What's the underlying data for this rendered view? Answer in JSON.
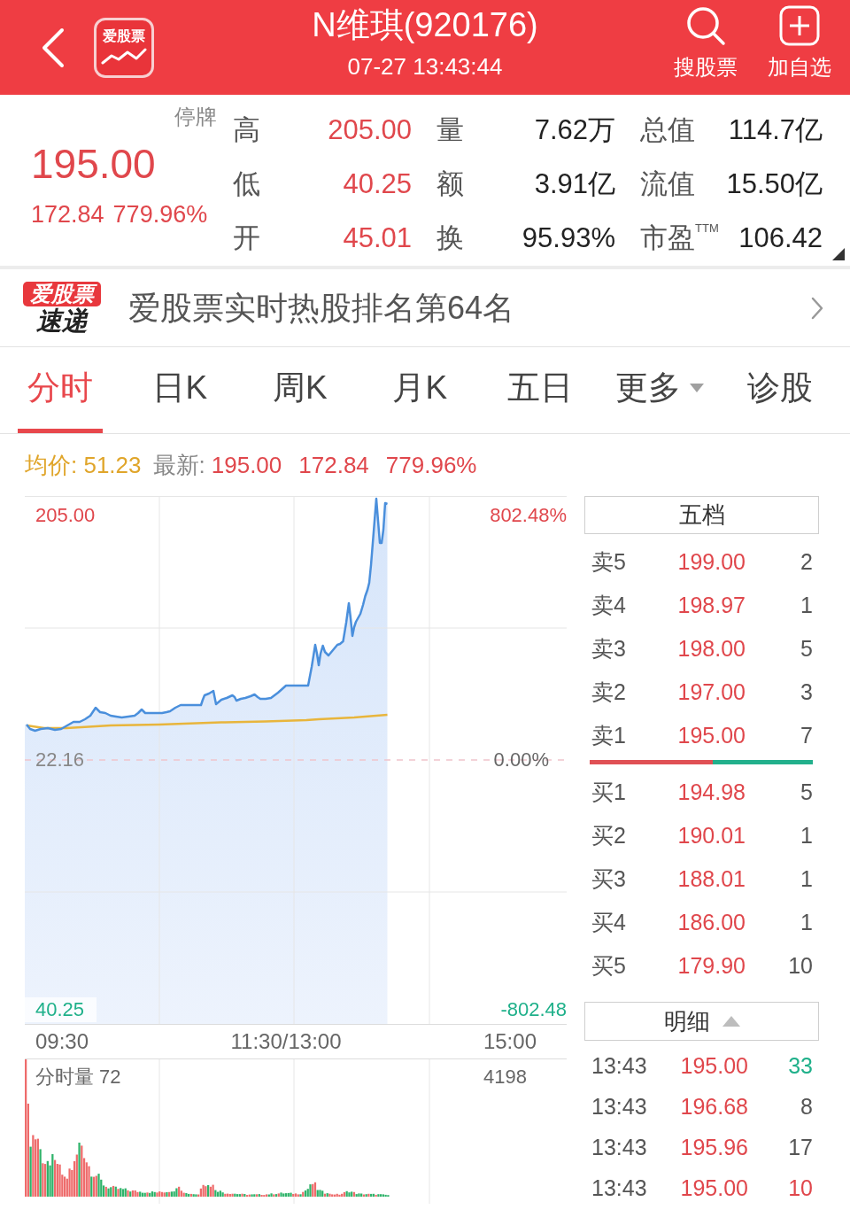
{
  "header": {
    "logo_text": "爱股票",
    "title": "N维琪(920176)",
    "time": "07-27 13:43:44",
    "actions": [
      {
        "kind": "search",
        "label": "搜股票"
      },
      {
        "kind": "add",
        "label": "加自选"
      }
    ]
  },
  "quote": {
    "status": "停牌",
    "price": "195.00",
    "change": "172.84",
    "change_percent": "779.96%",
    "stats": [
      {
        "label": "高",
        "value": "205.00",
        "color": "#e0474c"
      },
      {
        "label": "量",
        "value": "7.62万",
        "color": "#222222"
      },
      {
        "label": "总值",
        "value": "114.7亿",
        "color": "#222222"
      },
      {
        "label": "低",
        "value": "40.25",
        "color": "#e0474c"
      },
      {
        "label": "额",
        "value": "3.91亿",
        "color": "#222222"
      },
      {
        "label": "流值",
        "value": "15.50亿",
        "color": "#222222"
      },
      {
        "label": "开",
        "value": "45.01",
        "color": "#e0474c"
      },
      {
        "label": "换",
        "value": "95.93%",
        "color": "#222222"
      },
      {
        "label": "市盈$^{TTM}$",
        "value": "106.42",
        "color": "#222222"
      }
    ]
  },
  "banner": {
    "tag": "爱股票",
    "subtitle": "速递",
    "text": "爱股票实时热股排名第64名"
  },
  "tabs": [
    {
      "label": "分时",
      "selected": true,
      "dropdown": false
    },
    {
      "label": "日K",
      "selected": false,
      "dropdown": false
    },
    {
      "label": "周K",
      "selected": false,
      "dropdown": false
    },
    {
      "label": "月K",
      "selected": false,
      "dropdown": false
    },
    {
      "label": "五日",
      "selected": false,
      "dropdown": false
    },
    {
      "label": "更多",
      "selected": false,
      "dropdown": true
    },
    {
      "label": "诊股",
      "selected": false,
      "dropdown": false
    }
  ],
  "info_line": {
    "average": "均价: 51.23",
    "latest_label": "最新:",
    "latest": [
      "195.00",
      "172.84",
      "779.96%"
    ]
  },
  "price_chart": {
    "axis_left": [
      {
        "text": "205.00",
        "color": "#e0474c"
      },
      {
        "text": "22.16",
        "color": "#888888"
      },
      {
        "text": "40.25",
        "color": "#1fb08a"
      }
    ],
    "axis_right": [
      {
        "text": "802.48%",
        "color": "#e0474c"
      },
      {
        "text": "0.00%",
        "color": "#666666"
      },
      {
        "text": "-802.48",
        "color": "#1fb08a"
      }
    ],
    "time_axis": [
      "09:30",
      "11:30/13:00",
      "15:00"
    ]
  },
  "volume_chart": {
    "title": "分时量 72",
    "max_label": "4198"
  },
  "order_book": {
    "title": "五档",
    "asks": [
      {
        "label": "卖5",
        "price": "199.00",
        "volume": "2"
      },
      {
        "label": "卖4",
        "price": "198.97",
        "volume": "1"
      },
      {
        "label": "卖3",
        "price": "198.00",
        "volume": "5"
      },
      {
        "label": "卖2",
        "price": "197.00",
        "volume": "3"
      },
      {
        "label": "卖1",
        "price": "195.00",
        "volume": "7"
      }
    ],
    "balance": {
      "level": 0.55
    },
    "bids": [
      {
        "label": "买1",
        "price": "194.98",
        "volume": "5"
      },
      {
        "label": "买2",
        "price": "190.01",
        "volume": "1"
      },
      {
        "label": "买3",
        "price": "188.01",
        "volume": "1"
      },
      {
        "label": "买4",
        "price": "186.00",
        "volume": "1"
      },
      {
        "label": "买5",
        "price": "179.90",
        "volume": "10"
      }
    ]
  },
  "trades": {
    "title": "明细",
    "rows": [
      {
        "time": "13:43",
        "price": "195.00",
        "volume": "33",
        "color": "#1fb08a"
      },
      {
        "time": "13:43",
        "price": "196.68",
        "volume": "8",
        "color": "#555555"
      },
      {
        "time": "13:43",
        "price": "195.96",
        "volume": "17",
        "color": "#555555"
      },
      {
        "time": "13:43",
        "price": "195.00",
        "volume": "10",
        "color": "#e0474c"
      }
    ]
  }
}
